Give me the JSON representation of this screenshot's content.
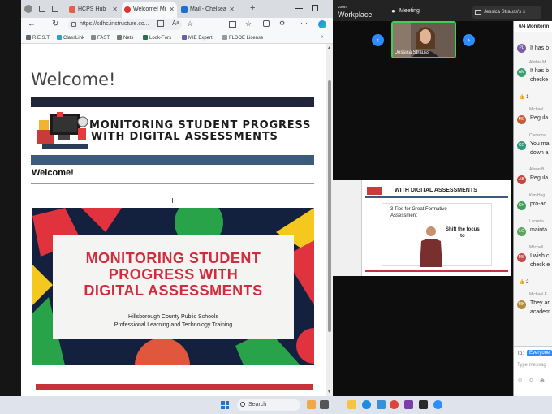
{
  "browser": {
    "tabs": [
      {
        "label": "HCPS Hub"
      },
      {
        "label": "Welcome! Mi"
      },
      {
        "label": "Mail - Chelsea"
      }
    ],
    "new_tab_label": "+",
    "url": "https://sdhc.instructure.co...",
    "favorites": [
      "R.E.S.T",
      "ClassLink",
      "FAST",
      "Nets",
      "Look-Fors",
      "MIE Expert",
      "FLDOE License"
    ]
  },
  "page": {
    "heading": "Welcome!",
    "banner_title_line1": "MONITORING STUDENT PROGRESS",
    "banner_title_line2": "WITH DIGITAL ASSESSMENTS",
    "subheading": "Welcome!",
    "poster": {
      "title_line1": "MONITORING STUDENT",
      "title_line2": "PROGRESS WITH",
      "title_line3": "DIGITAL ASSESSMENTS",
      "subtitle_line1": "Hillsborough County Public Schools",
      "subtitle_line2": "Professional Learning and Technology Training"
    }
  },
  "zoom": {
    "logo_line1": "zoom",
    "logo_line2": "Workplace",
    "meeting_label": "Meeting",
    "sharing_label": "Jessica Strauss's s",
    "camera_name": "Jessica Strauss",
    "shared_slide": {
      "header": "WITH DIGITAL ASSESSMENTS",
      "slide_title_line1": "3 Tips for Great Formative",
      "slide_title_line2": "Assessment",
      "focus_line1": "Shift the focus",
      "focus_line2": "to"
    },
    "chat": {
      "header": "6/4 Monitorin",
      "messages": [
        {
          "initials": "PL",
          "name": "",
          "text": "It has b",
          "color": "#7a5ea8"
        },
        {
          "initials": "AM",
          "name": "Alishia M",
          "text": "It has b",
          "color": "#3a9e6e"
        },
        {
          "initials": "",
          "name": "",
          "text": "checke",
          "color": ""
        },
        {
          "initials": "MC",
          "name": "Michael",
          "text": "Regula",
          "color": "#c85c3a"
        },
        {
          "initials": "CC",
          "name": "Clarence",
          "text": "You ma",
          "color": "#2f9a7a"
        },
        {
          "initials": "",
          "name": "",
          "text": "down a",
          "color": ""
        },
        {
          "initials": "AB",
          "name": "Alison B",
          "text": "Regula",
          "color": "#c8463e"
        },
        {
          "initials": "KH",
          "name": "Kim Hag",
          "text": "pro-ac",
          "color": "#3f9e5a"
        },
        {
          "initials": "LC",
          "name": "Lucretia",
          "text": "mainta",
          "color": "#5aa55a"
        },
        {
          "initials": "MS",
          "name": "Mitchell",
          "text": "I wish c",
          "color": "#c84a4a"
        },
        {
          "initials": "",
          "name": "",
          "text": "check e",
          "color": ""
        },
        {
          "initials": "MK",
          "name": "Michael F",
          "text": "They ar",
          "color": "#b58b3e"
        },
        {
          "initials": "",
          "name": "",
          "text": "academ",
          "color": ""
        }
      ],
      "reaction_1": "👍 1",
      "reaction_2": "👍 2",
      "to_label": "To:",
      "to_value": "Everyone",
      "input_placeholder": "Type messag"
    }
  },
  "taskbar": {
    "search_placeholder": "Search"
  }
}
